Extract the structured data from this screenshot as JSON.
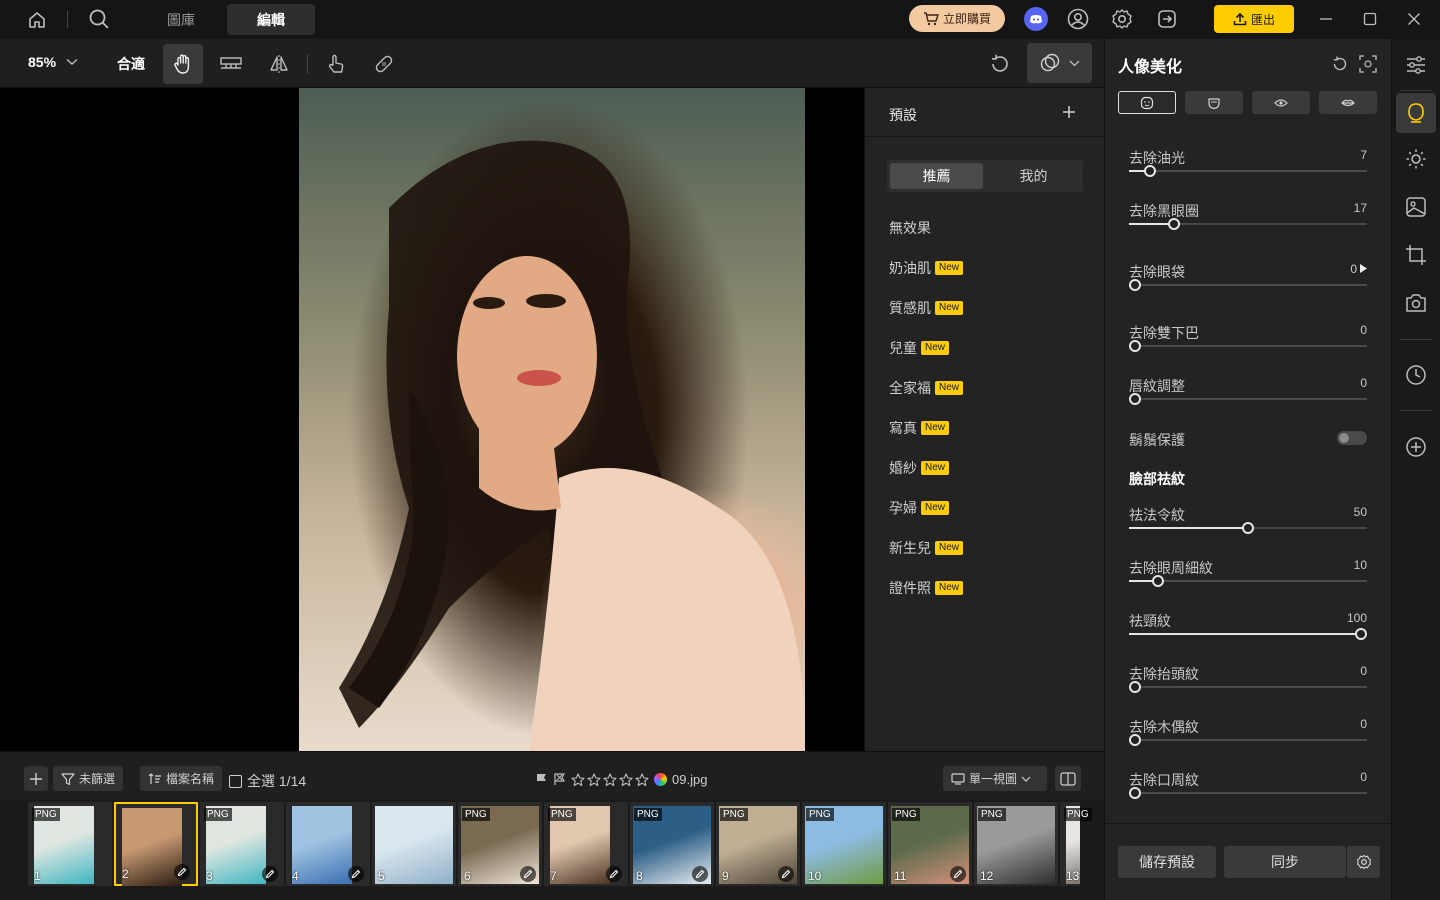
{
  "titlebar": {
    "tabs": [
      {
        "label": "圖庫"
      },
      {
        "label": "編輯"
      }
    ],
    "buy_label": "立即購買",
    "export_label": "匯出"
  },
  "toolbar": {
    "zoom": "85%",
    "fit_label": "合適"
  },
  "presets": {
    "title": "預設",
    "tab_recommended": "推薦",
    "tab_mine": "我的",
    "items": [
      {
        "label": "無效果",
        "badge": ""
      },
      {
        "label": "奶油肌",
        "badge": "New"
      },
      {
        "label": "質感肌",
        "badge": "New"
      },
      {
        "label": "兒童",
        "badge": "New"
      },
      {
        "label": "全家福",
        "badge": "New"
      },
      {
        "label": "寫真",
        "badge": "New"
      },
      {
        "label": "婚紗",
        "badge": "New"
      },
      {
        "label": "孕婦",
        "badge": "New"
      },
      {
        "label": "新生兒",
        "badge": "New"
      },
      {
        "label": "證件照",
        "badge": "New"
      }
    ]
  },
  "adjust": {
    "title": "人像美化",
    "sliders_top": [
      {
        "label": "去除油光",
        "value": "7",
        "pct": 0.09
      },
      {
        "label": "去除黑眼圈",
        "value": "17",
        "pct": 0.19
      },
      {
        "label": "去除眼袋",
        "value": "0",
        "pct": 0
      },
      {
        "label": "去除雙下巴",
        "value": "0",
        "pct": 0
      },
      {
        "label": "唇紋調整",
        "value": "0",
        "pct": 0
      }
    ],
    "beard_label": "鬍鬚保護",
    "section_wrinkle": "臉部祛紋",
    "sliders_bottom": [
      {
        "label": "祛法令紋",
        "value": "50",
        "pct": 0.5
      },
      {
        "label": "去除眼周細紋",
        "value": "10",
        "pct": 0.12
      },
      {
        "label": "祛頸紋",
        "value": "100",
        "pct": 1.0
      },
      {
        "label": "去除抬頭紋",
        "value": "0",
        "pct": 0
      },
      {
        "label": "去除木偶紋",
        "value": "0",
        "pct": 0
      },
      {
        "label": "去除口周紋",
        "value": "0",
        "pct": 0
      }
    ],
    "save_preset_label": "儲存預設",
    "sync_label": "同步"
  },
  "bottombar": {
    "filter_label": "未篩選",
    "sort_label": "檔案名稱",
    "select_all_label": "全選 1/14",
    "filename": "09.jpg",
    "view_label": "單一視圖"
  },
  "filmstrip": {
    "thumbs": [
      {
        "num": "1",
        "png": "PNG",
        "edited": false,
        "colors": [
          "#dfe6e0",
          "#3fb6c2"
        ]
      },
      {
        "num": "2",
        "png": "",
        "edited": true,
        "colors": [
          "#c79a73",
          "#2a1b10"
        ]
      },
      {
        "num": "3",
        "png": "PNG",
        "edited": true,
        "colors": [
          "#dfe6e0",
          "#3fb6c2"
        ]
      },
      {
        "num": "4",
        "png": "",
        "edited": true,
        "colors": [
          "#9ec2e0",
          "#3b6fb3"
        ]
      },
      {
        "num": "5",
        "png": "",
        "edited": false,
        "colors": [
          "#d9e6ee",
          "#8fb0c8"
        ]
      },
      {
        "num": "6",
        "png": "PNG",
        "edited": true,
        "colors": [
          "#7a6a52",
          "#f0e6d8"
        ]
      },
      {
        "num": "7",
        "png": "PNG",
        "edited": true,
        "colors": [
          "#e0c8ae",
          "#4a3322"
        ]
      },
      {
        "num": "8",
        "png": "PNG",
        "edited": true,
        "colors": [
          "#2d5f86",
          "#e9eef2"
        ]
      },
      {
        "num": "9",
        "png": "PNG",
        "edited": true,
        "colors": [
          "#bfae92",
          "#4d4438"
        ]
      },
      {
        "num": "10",
        "png": "PNG",
        "edited": false,
        "colors": [
          "#8dbbe2",
          "#6f9b43"
        ]
      },
      {
        "num": "11",
        "png": "PNG",
        "edited": true,
        "colors": [
          "#5d6b4c",
          "#d4907a"
        ]
      },
      {
        "num": "12",
        "png": "PNG",
        "edited": false,
        "colors": [
          "#9a9a9a",
          "#2e2e2e"
        ]
      },
      {
        "num": "13",
        "png": "PNG",
        "edited": false,
        "colors": [
          "#e8e6e2",
          "#7b7570"
        ]
      }
    ]
  },
  "colors": {
    "accent": "#ffcc00",
    "buy": "#f3c9a0",
    "discord": "#5865f2"
  }
}
